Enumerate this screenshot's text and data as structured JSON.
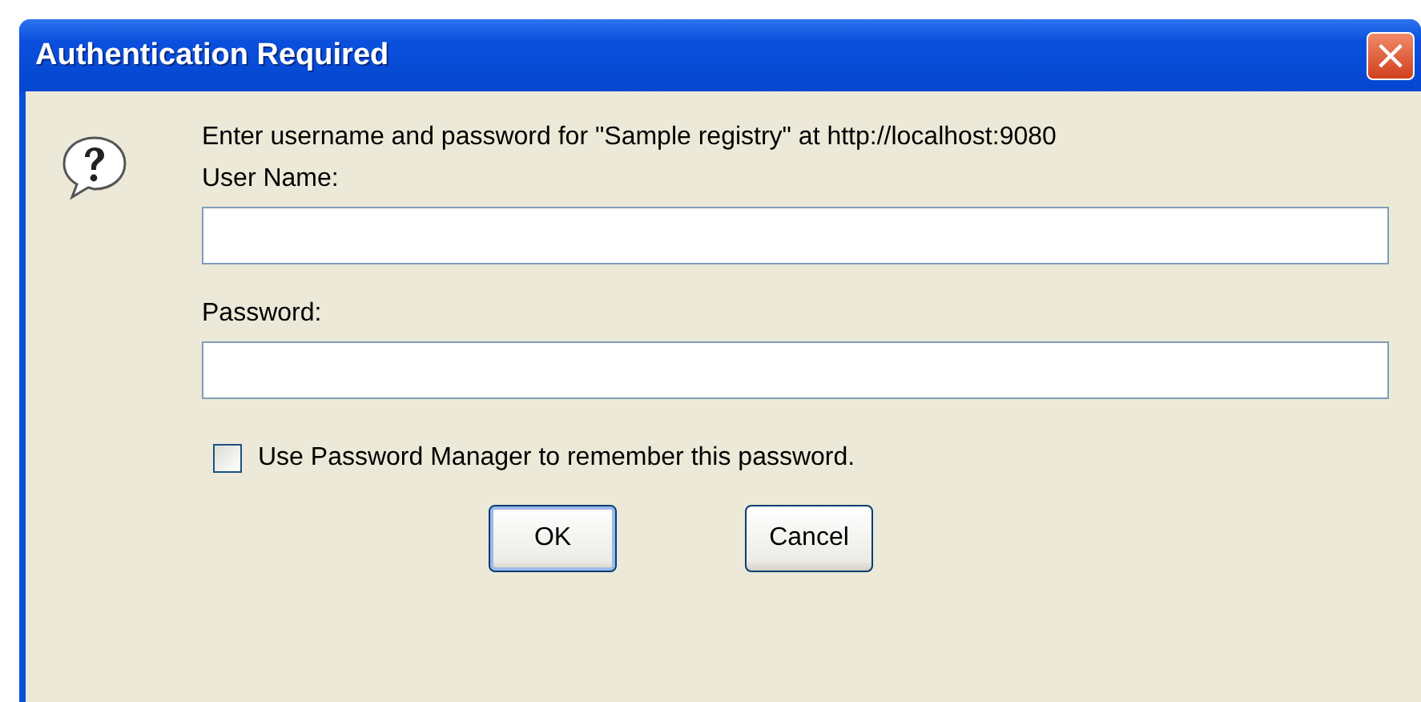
{
  "window": {
    "title": "Authentication Required",
    "close": "×"
  },
  "message": "Enter username and password for \"Sample registry\" at http://localhost:9080",
  "fields": [
    {
      "label": "User Name:"
    },
    {
      "label": "Password:"
    }
  ],
  "remember": {
    "label": "Use Password Manager to remember this password.",
    "checked": false
  },
  "buttons": [
    {
      "label": "OK",
      "default": true
    },
    {
      "label": "Cancel",
      "default": false
    }
  ]
}
